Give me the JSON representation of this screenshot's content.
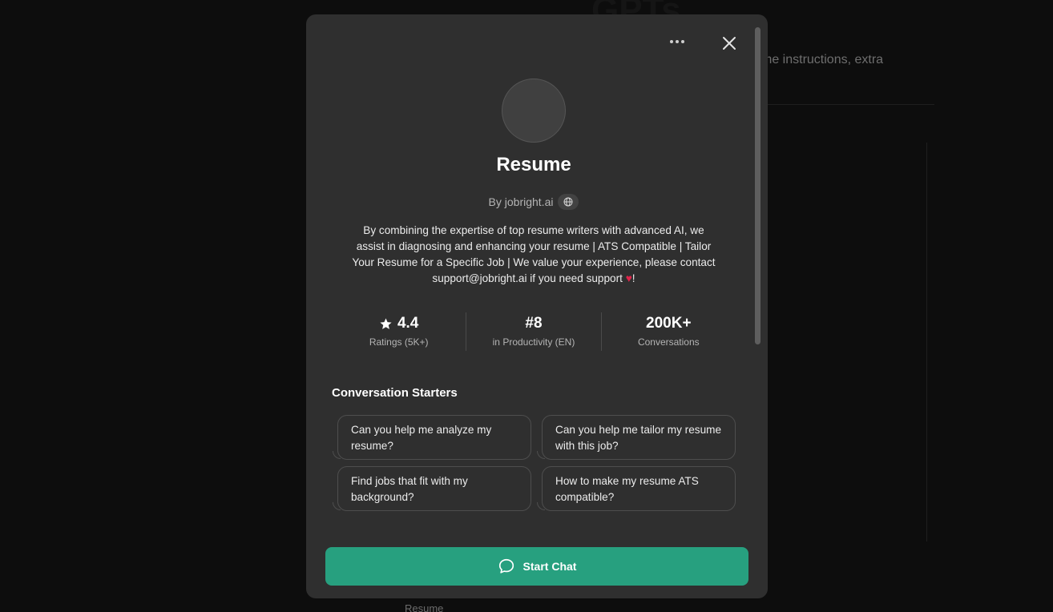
{
  "background": {
    "title": "GPTs",
    "description_fragment": "me instructions, extra",
    "bottom_label": "Resume"
  },
  "modal": {
    "name": "Resume",
    "author": "By jobright.ai",
    "description_main": "By combining the expertise of top resume writers with advanced AI, we assist in diagnosing and enhancing your resume | ATS Compatible | Tailor Your Resume for a Specific Job | We value your experience, please contact support@jobright.ai if you need support",
    "description_end": "!",
    "stats": [
      {
        "value": "4.4",
        "label": "Ratings (5K+)"
      },
      {
        "value": "#8",
        "label": "in Productivity (EN)"
      },
      {
        "value": "200K+",
        "label": "Conversations"
      }
    ],
    "starters_heading": "Conversation Starters",
    "starters": [
      "Can you help me analyze my resume?",
      "Can you help me tailor my resume with this job?",
      "Find jobs that fit with my background?",
      "How to make my resume ATS compatible?"
    ],
    "start_chat_label": "Start Chat"
  },
  "icons": {
    "more": "more-icon",
    "close": "close-icon",
    "globe": "globe-icon",
    "star": "star-icon",
    "heart": "heart-icon",
    "chat": "chat-bubble-icon"
  },
  "colors": {
    "accent": "#27a07f",
    "modal_bg": "#2f2f2f",
    "heart": "#e0244a"
  }
}
